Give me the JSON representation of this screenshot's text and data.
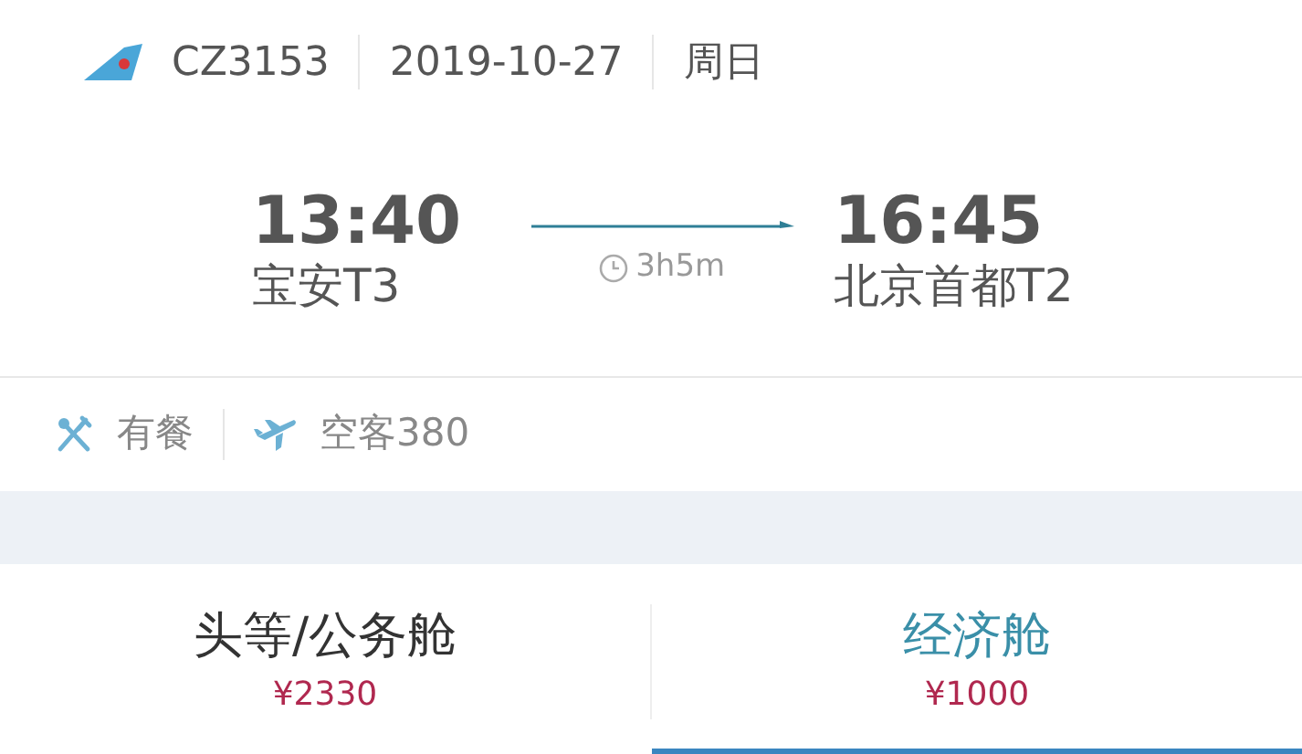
{
  "flight": {
    "number": "CZ3153",
    "date": "2019-10-27",
    "weekday": "周日"
  },
  "departure": {
    "time": "13:40",
    "airport": "宝安T3"
  },
  "duration": "3h5m",
  "arrival": {
    "time": "16:45",
    "airport": "北京首都T2"
  },
  "amenities": [
    {
      "kind": "meal",
      "label": "有餐"
    },
    {
      "kind": "aircraft",
      "label": "空客380"
    }
  ],
  "cabin_tabs": [
    {
      "label": "头等/公务舱",
      "price": "¥2330",
      "selected": false
    },
    {
      "label": "经济舱",
      "price": "¥1000",
      "selected": true
    }
  ]
}
